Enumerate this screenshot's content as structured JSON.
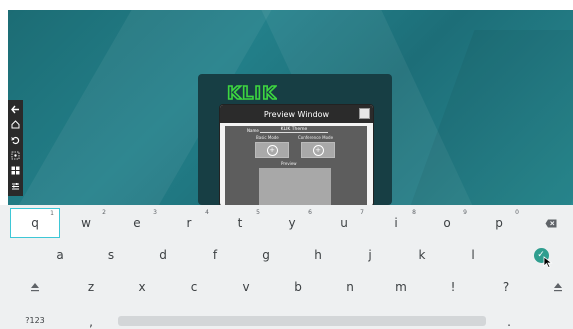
{
  "app": {
    "logo_text": "KLIK",
    "logo_color": "#3dd640"
  },
  "side_toolbar": {
    "icons": [
      "exit-icon",
      "home-icon",
      "undo-icon",
      "screenshot-icon",
      "apps-icon",
      "settings-icon"
    ]
  },
  "preview_window": {
    "title": "Preview Window",
    "name_label": "Name",
    "name_value": "KLIK Theme",
    "col1_label": "Basic Mode",
    "col2_label": "Conference Mode",
    "preview_label": "Preview"
  },
  "keyboard": {
    "row1": [
      {
        "k": "q",
        "alt": "1"
      },
      {
        "k": "w",
        "alt": "2"
      },
      {
        "k": "e",
        "alt": "3"
      },
      {
        "k": "r",
        "alt": "4"
      },
      {
        "k": "t",
        "alt": "5"
      },
      {
        "k": "y",
        "alt": "6"
      },
      {
        "k": "u",
        "alt": "7"
      },
      {
        "k": "i",
        "alt": "8"
      },
      {
        "k": "o",
        "alt": "9"
      },
      {
        "k": "p",
        "alt": "0"
      }
    ],
    "row2": [
      "a",
      "s",
      "d",
      "f",
      "g",
      "h",
      "j",
      "k",
      "l"
    ],
    "row3": [
      "z",
      "x",
      "c",
      "v",
      "b",
      "n",
      "m",
      "!",
      "?"
    ],
    "symbols_label": "?123",
    "comma": ",",
    "period": ".",
    "accent_color": "#2f9e8f"
  }
}
